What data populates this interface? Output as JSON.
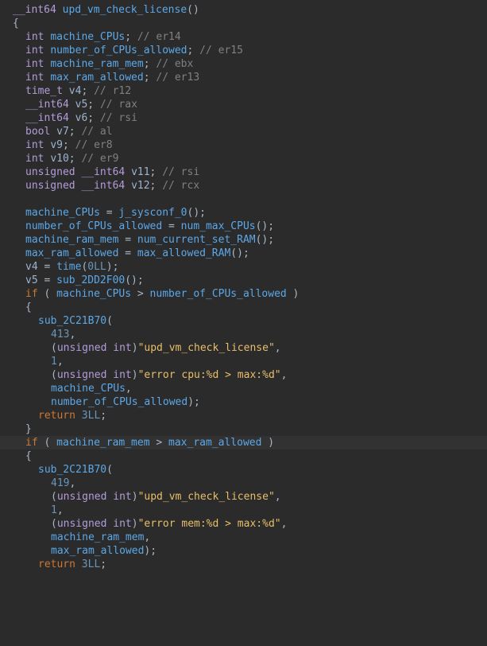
{
  "code": {
    "ret_type": "__int64",
    "func_name": "upd_vm_check_license",
    "decls": [
      {
        "type": "int",
        "name": "machine_CPUs",
        "comment": "// er14",
        "renamed": true
      },
      {
        "type": "int",
        "name": "number_of_CPUs_allowed",
        "comment": "// er15",
        "renamed": true
      },
      {
        "type": "int",
        "name": "machine_ram_mem",
        "comment": "// ebx",
        "renamed": true
      },
      {
        "type": "int",
        "name": "max_ram_allowed",
        "comment": "// er13",
        "renamed": true
      },
      {
        "type": "time_t",
        "name": "v4",
        "comment": "// r12",
        "renamed": false
      },
      {
        "type": "__int64",
        "name": "v5",
        "comment": "// rax",
        "renamed": false
      },
      {
        "type": "__int64",
        "name": "v6",
        "comment": "// rsi",
        "renamed": false
      },
      {
        "type": "bool",
        "name": "v7",
        "comment": "// al",
        "renamed": false
      },
      {
        "type": "int",
        "name": "v9",
        "comment": "// er8",
        "renamed": false
      },
      {
        "type": "int",
        "name": "v10",
        "comment": "// er9",
        "renamed": false
      },
      {
        "type": "unsigned __int64",
        "name": "v11",
        "comment": "// rsi",
        "renamed": false
      },
      {
        "type": "unsigned __int64",
        "name": "v12",
        "comment": "// rcx",
        "renamed": false
      }
    ],
    "assign1": {
      "lhs": "machine_CPUs",
      "rhs_func": "j_sysconf_0"
    },
    "assign2": {
      "lhs": "number_of_CPUs_allowed",
      "rhs_func": "num_max_CPUs"
    },
    "assign3": {
      "lhs": "machine_ram_mem",
      "rhs_func": "num_current_set_RAM"
    },
    "assign4": {
      "lhs": "max_ram_allowed",
      "rhs_func": "max_allowed_RAM"
    },
    "assign5": {
      "lhs": "v4",
      "rhs_func": "time",
      "arg": "0LL"
    },
    "assign6": {
      "lhs": "v5",
      "rhs_func": "sub_2DD2F00"
    },
    "if1": {
      "kw": "if",
      "lhs": "machine_CPUs",
      "op": ">",
      "rhs": "number_of_CPUs_allowed"
    },
    "call1": {
      "func": "sub_2C21B70",
      "arg1": "413",
      "cast": "unsigned int",
      "str1": "\"upd_vm_check_license\"",
      "arg3": "1",
      "str2": "\"error cpu:%d > max:%d\"",
      "arg5": "machine_CPUs",
      "arg6": "number_of_CPUs_allowed"
    },
    "return1": {
      "kw": "return",
      "val": "3LL"
    },
    "if2": {
      "kw": "if",
      "lhs": "machine_ram_mem",
      "op": ">",
      "rhs": "max_ram_allowed"
    },
    "call2": {
      "func": "sub_2C21B70",
      "arg1": "419",
      "cast": "unsigned int",
      "str1": "\"upd_vm_check_license\"",
      "arg3": "1",
      "str2": "\"error mem:%d > max:%d\"",
      "arg5": "machine_ram_mem",
      "arg6": "max_ram_allowed"
    },
    "return2": {
      "kw": "return",
      "val": "3LL"
    },
    "brace_open": "{",
    "brace_close": "}",
    "paren_open": "(",
    "paren_close": ")",
    "semicolon": ";",
    "comma": ",",
    "eq": " = ",
    "space": " "
  }
}
